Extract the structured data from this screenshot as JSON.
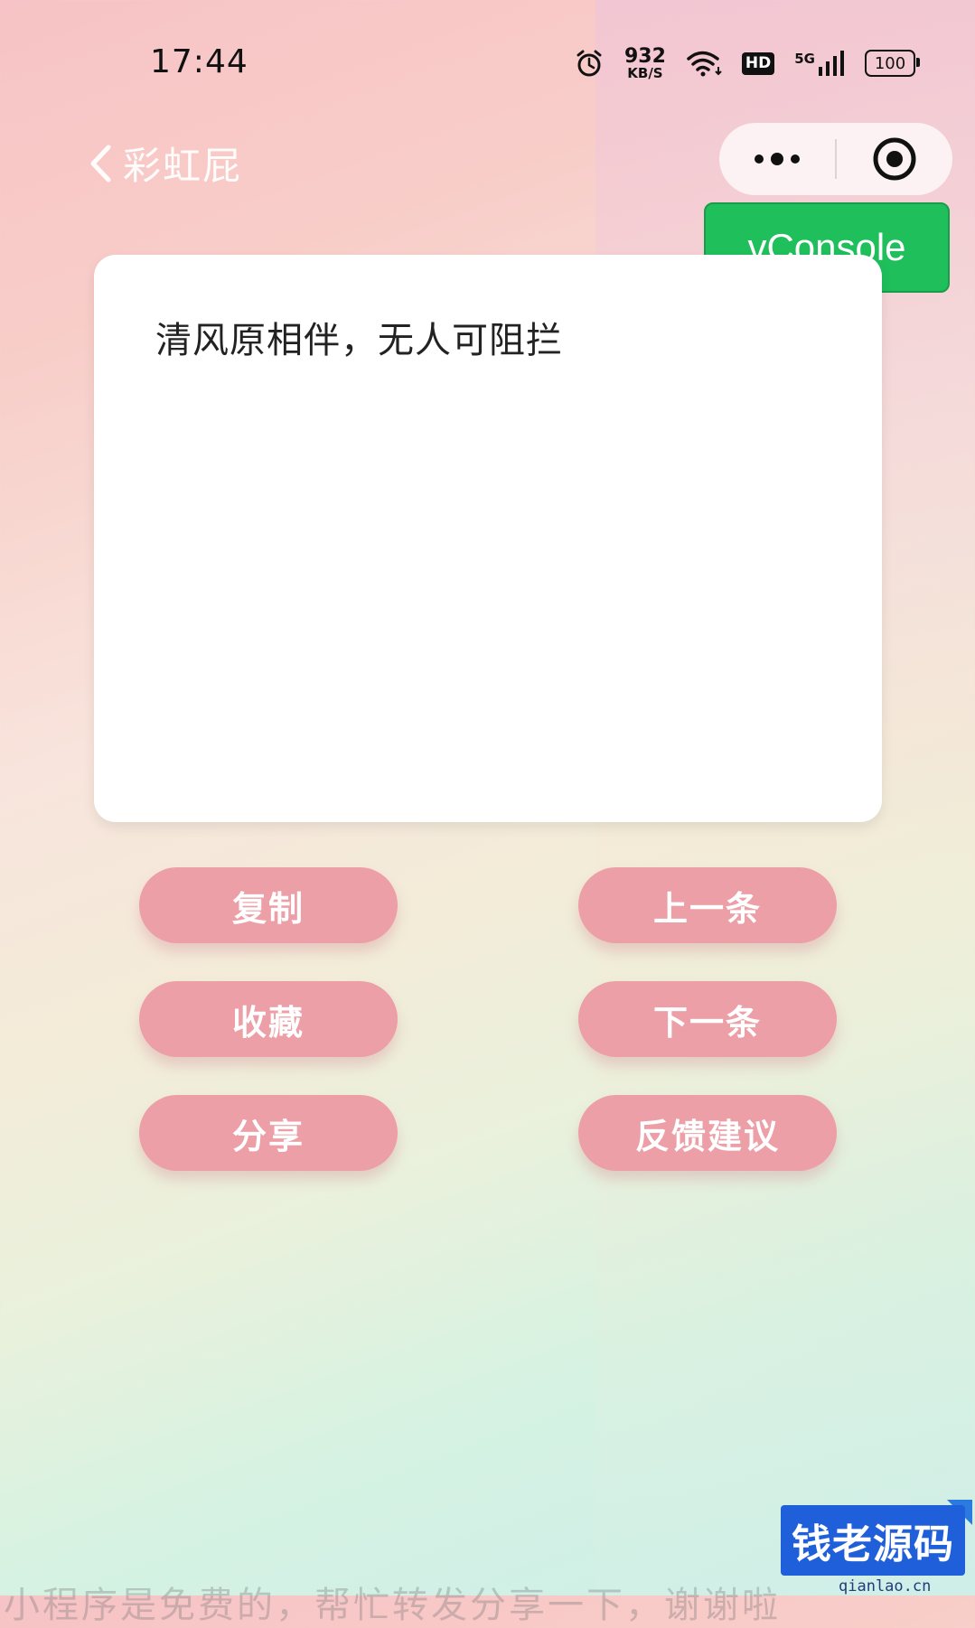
{
  "status_bar": {
    "time": "17:44",
    "net_speed_value": "932",
    "net_speed_unit": "KB/S",
    "hd_label": "HD",
    "network_label": "5G",
    "battery_level": "100",
    "icons": [
      "alarm-icon",
      "wifi-icon",
      "signal-icon",
      "battery-icon"
    ]
  },
  "nav": {
    "title": "彩虹屁",
    "capsule_icons": [
      "more-dots-icon",
      "record-target-icon"
    ]
  },
  "vconsole": {
    "label": "vConsole",
    "color": "#1fbf5c"
  },
  "card": {
    "quote": "清风原相伴，无人可阻拦"
  },
  "actions": {
    "copy": "复制",
    "prev": "上一条",
    "favorite": "收藏",
    "next": "下一条",
    "share": "分享",
    "feedback": "反馈建议",
    "button_color": "#ec9fa6"
  },
  "footer": {
    "note": "小程序是免费的，帮忙转发分享一下，谢谢啦"
  },
  "watermark": {
    "brand": "钱老源码",
    "url": "qianlao.cn"
  }
}
